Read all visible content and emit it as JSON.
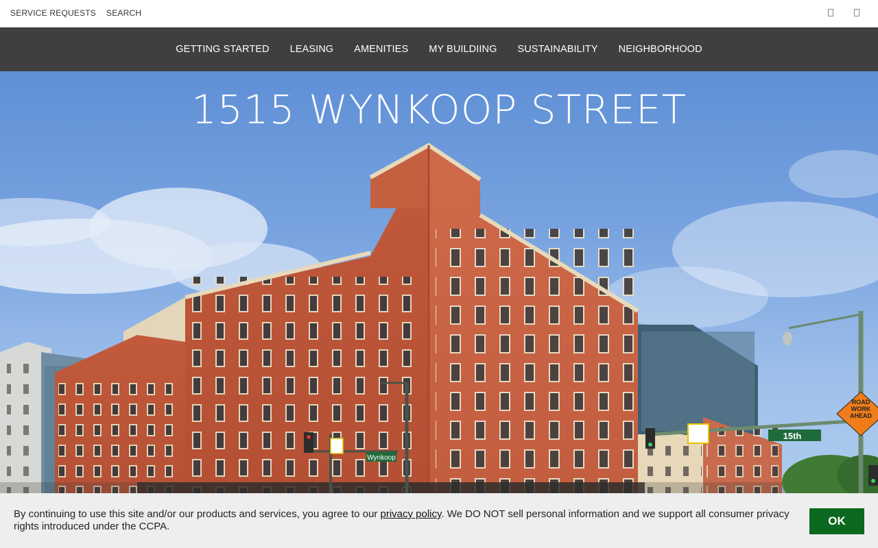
{
  "utility_bar": {
    "links": [
      "SERVICE REQUESTS",
      "SEARCH"
    ],
    "icons": [
      "facebook-icon",
      "instagram-icon"
    ]
  },
  "main_nav": {
    "items": [
      "GETTING STARTED",
      "LEASING",
      "AMENITIES",
      "MY BUILDIING",
      "SUSTAINABILITY",
      "NEIGHBORHOOD"
    ]
  },
  "hero": {
    "title": "1515 WYNKOOP STREET",
    "image_subject": "red brick office building at street corner",
    "street_signs": {
      "wynkoop": "Wynkoop",
      "fifteenth": "15th",
      "road_work": [
        "ROAD",
        "WORK",
        "AHEAD"
      ]
    }
  },
  "cookie_banner": {
    "text_before_link": "By continuing to use this site and/or our products and services, you agree to our ",
    "link_text": "privacy policy",
    "text_after_link": ". We DO NOT sell personal information and we support all consumer privacy rights introduced under the CCPA.",
    "ok_label": "OK"
  },
  "colors": {
    "nav_background": "#3f3f3f",
    "ok_button": "#0b6a1f",
    "banner_background": "#eeeeee",
    "brick": "#c65a3a"
  }
}
